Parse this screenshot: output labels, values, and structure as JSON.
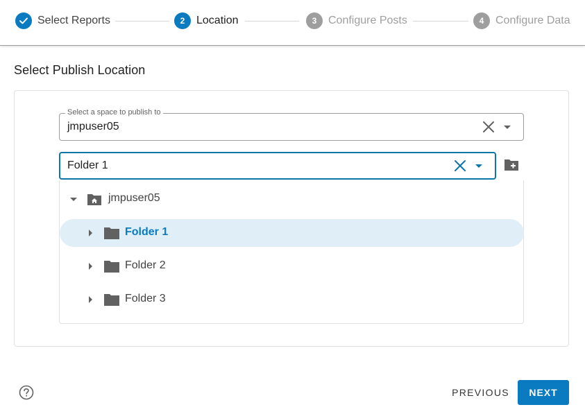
{
  "stepper": {
    "steps": [
      {
        "number": "1",
        "label": "Select Reports",
        "state": "done"
      },
      {
        "number": "2",
        "label": "Location",
        "state": "active"
      },
      {
        "number": "3",
        "label": "Configure Posts",
        "state": "pending"
      },
      {
        "number": "4",
        "label": "Configure Data",
        "state": "pending"
      }
    ]
  },
  "page": {
    "title": "Select Publish Location"
  },
  "space_select": {
    "label": "Select a space to publish to",
    "value": "jmpuser05",
    "clear_icon": "close-icon",
    "dropdown_icon": "caret-down-icon"
  },
  "folder_select": {
    "value": "Folder 1",
    "clear_icon": "close-icon",
    "dropdown_icon": "caret-down-icon",
    "add_folder_icon": "create-new-folder-icon"
  },
  "tree": {
    "root": {
      "label": "jmpuser05",
      "icon": "home-folder-icon",
      "expanded": true
    },
    "children": [
      {
        "label": "Folder 1",
        "icon": "folder-icon",
        "selected": true,
        "expanded": false
      },
      {
        "label": "Folder 2",
        "icon": "folder-icon",
        "selected": false,
        "expanded": false
      },
      {
        "label": "Folder 3",
        "icon": "folder-icon",
        "selected": false,
        "expanded": false
      }
    ]
  },
  "footer": {
    "help_icon": "help-circle-icon",
    "previous_label": "PREVIOUS",
    "next_label": "NEXT"
  },
  "colors": {
    "accent": "#0b7bc1",
    "selected_row_bg": "#e0eef8",
    "pending_step": "#9e9e9e"
  }
}
